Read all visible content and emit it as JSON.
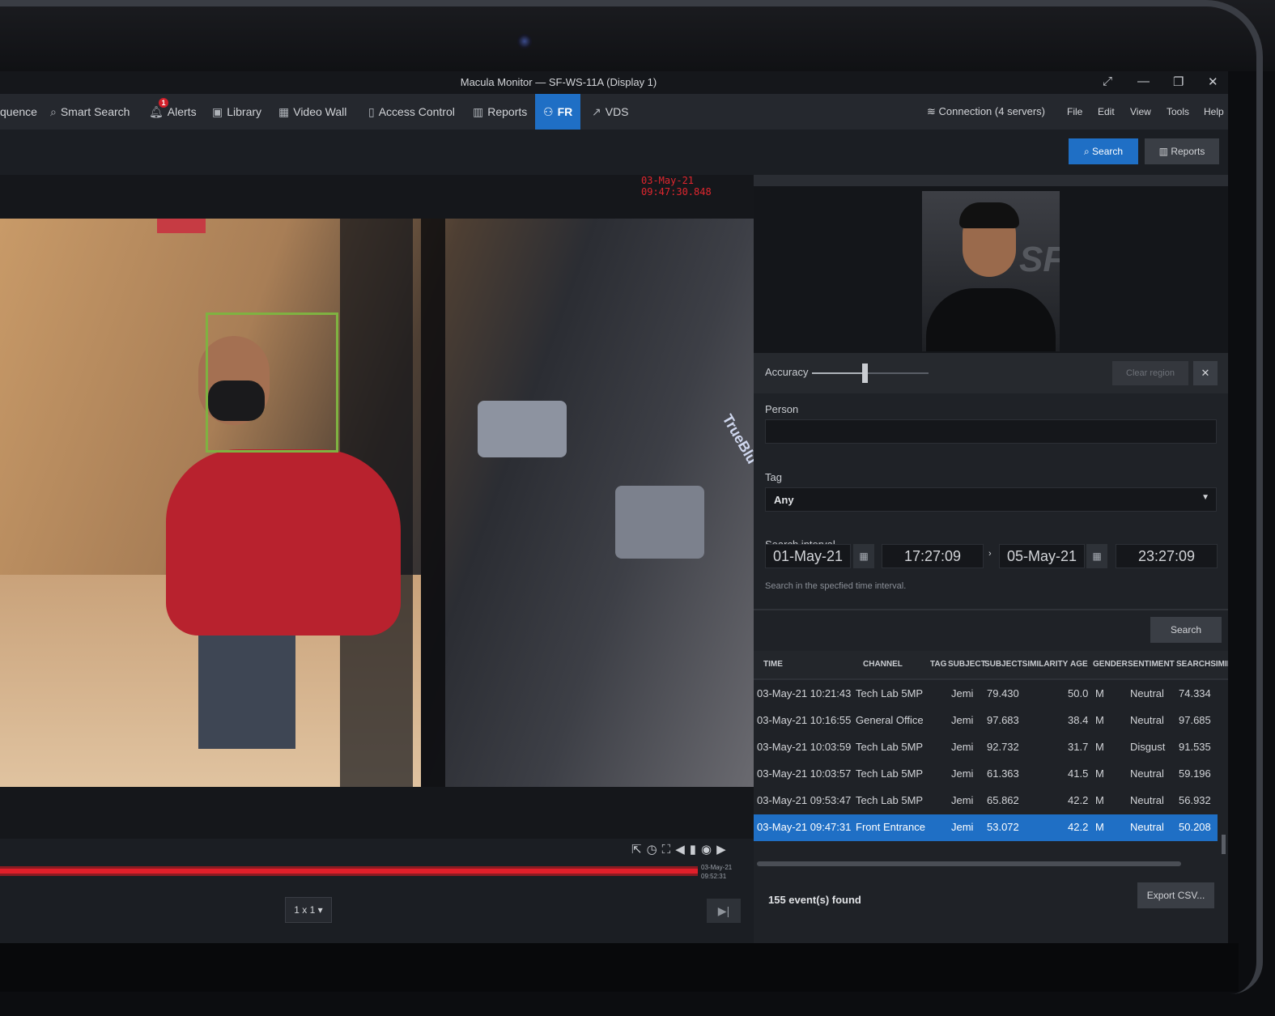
{
  "window": {
    "title": "Macula Monitor — SF-WS-11A (Display 1)"
  },
  "nav": [
    {
      "label": "quence",
      "icon": "sequence-icon"
    },
    {
      "label": "Smart Search",
      "icon": "smart-search-icon"
    },
    {
      "label": "Alerts",
      "icon": "bell-icon",
      "badge": "1"
    },
    {
      "label": "Library",
      "icon": "library-icon"
    },
    {
      "label": "Video Wall",
      "icon": "grid-icon"
    },
    {
      "label": "Access Control",
      "icon": "door-icon"
    },
    {
      "label": "Reports",
      "icon": "bar-chart-icon"
    },
    {
      "label": "FR",
      "icon": "person-icon",
      "active": true
    },
    {
      "label": "VDS",
      "icon": "external-icon"
    }
  ],
  "menu": {
    "connection": "Connection (4 servers)",
    "file": "File",
    "edit": "Edit",
    "view": "View",
    "tools": "Tools",
    "help": "Help"
  },
  "toolbar": {
    "search": "Search",
    "reports": "Reports"
  },
  "video": {
    "timestamp": "03-May-21 09:47:30.848",
    "end_date": "03-May-21",
    "end_time": "09:52:31",
    "layout": "1 x 1"
  },
  "panel": {
    "accuracy_label": "Accuracy",
    "accuracy_level": 0.45,
    "clear_region": "Clear region",
    "person_label": "Person",
    "person_value": "",
    "tag_label": "Tag",
    "tag_value": "Any",
    "interval_label": "Search interval",
    "from_date": "01-May-21",
    "from_time": "17:27:09",
    "to_date": "05-May-21",
    "to_time": "23:27:09",
    "hint": "Search in the specfied time interval.",
    "search_button": "Search",
    "found": "155 event(s) found",
    "export": "Export CSV..."
  },
  "table": {
    "headers": [
      "TIME",
      "CHANNEL",
      "TAG",
      "SUBJECT",
      "SUBJECTSIMILARITY",
      "AGE",
      "GENDER",
      "SENTIMENT",
      "SEARCHSIMIL"
    ],
    "rows": [
      [
        "03-May-21 10:21:43",
        "Tech Lab 5MP",
        "",
        "Jemi",
        "79.430",
        "50.0",
        "M",
        "Neutral",
        "74.334"
      ],
      [
        "03-May-21 10:16:55",
        "General Office",
        "",
        "Jemi",
        "97.683",
        "38.4",
        "M",
        "Neutral",
        "97.685"
      ],
      [
        "03-May-21 10:03:59",
        "Tech Lab 5MP",
        "",
        "Jemi",
        "92.732",
        "31.7",
        "M",
        "Disgust",
        "91.535"
      ],
      [
        "03-May-21 10:03:57",
        "Tech Lab 5MP",
        "",
        "Jemi",
        "61.363",
        "41.5",
        "M",
        "Neutral",
        "59.196"
      ],
      [
        "03-May-21 09:53:47",
        "Tech Lab 5MP",
        "",
        "Jemi",
        "65.862",
        "42.2",
        "M",
        "Neutral",
        "56.932"
      ],
      [
        "03-May-21 09:47:31",
        "Front Entrance",
        "",
        "Jemi",
        "53.072",
        "42.2",
        "M",
        "Neutral",
        "50.208"
      ]
    ],
    "selected_row": 5
  },
  "colors": {
    "accent": "#1f6fc5",
    "face_box": "#7fb241",
    "timestamp": "#e0262e",
    "timeline": "#e11f2a"
  }
}
